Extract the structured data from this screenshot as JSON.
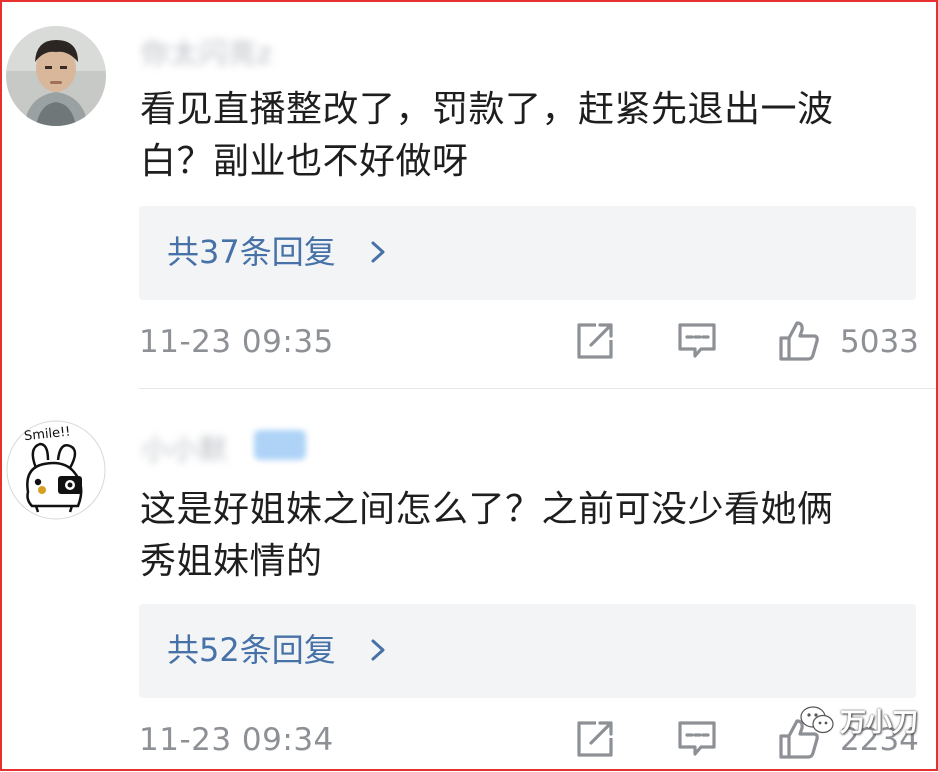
{
  "comments": [
    {
      "username": "你太闪亮z",
      "text_line1": "看见直播整改了，罚款了，赶紧先退出一波",
      "text_line2": "白？副业也不好做呀",
      "replies_label": "共37条回复",
      "timestamp": "11-23 09:35",
      "likes": "5033"
    },
    {
      "username": "小小默",
      "text_line1": "这是好姐妹之间怎么了？之前可没少看她俩",
      "text_line2": "秀姐妹情的",
      "replies_label": "共52条回复",
      "timestamp": "11-23 09:34",
      "likes": "2234"
    }
  ],
  "avatar2_caption": "Smile!!",
  "watermark": "万小刀",
  "colors": {
    "frame": "#e8302f",
    "link": "#4672a8",
    "meta": "#8d9095",
    "reply_bg": "#f3f4f6"
  },
  "icons": {
    "share": "share-icon",
    "comment": "comment-icon",
    "like": "thumbs-up-icon",
    "chevron": "chevron-right-icon",
    "watermark": "wechat-logo-icon"
  }
}
